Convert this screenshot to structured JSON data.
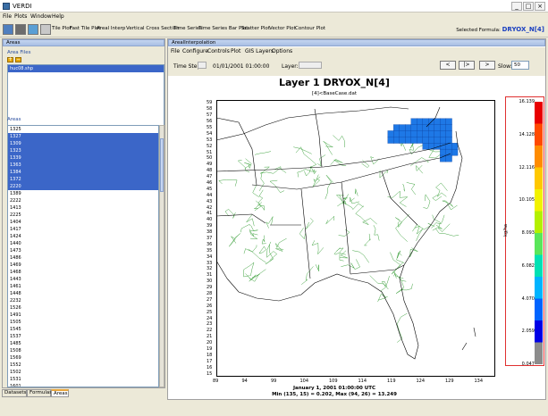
{
  "window": {
    "title": "VERDI"
  },
  "menu": [
    "File",
    "Plots",
    "Window",
    "Help"
  ],
  "toolbar": {
    "buttons": [
      "Tile Plot",
      "Fast Tile Plot",
      "Areal Interp",
      "Vertical Cross Section",
      "Time Series",
      "Time Series Bar Plot",
      "Scatter Plot",
      "Vector Plot",
      "Contour Plot"
    ],
    "selected_formula_label": "Selected Formula:",
    "selected_formula": "DRYOX_N[4]"
  },
  "left_panel": {
    "header": "Areas",
    "area_files_label": "Area Files",
    "area_files": [
      "huc08.shp"
    ],
    "areas_label": "Areas",
    "areas": [
      {
        "id": "1325",
        "selected": false
      },
      {
        "id": "1327",
        "selected": true
      },
      {
        "id": "1309",
        "selected": true
      },
      {
        "id": "1323",
        "selected": true
      },
      {
        "id": "1339",
        "selected": true
      },
      {
        "id": "1363",
        "selected": true
      },
      {
        "id": "1384",
        "selected": true
      },
      {
        "id": "1372",
        "selected": true
      },
      {
        "id": "2220",
        "selected": true
      },
      {
        "id": "1389",
        "selected": false
      },
      {
        "id": "2222",
        "selected": false
      },
      {
        "id": "1413",
        "selected": false
      },
      {
        "id": "2225",
        "selected": false
      },
      {
        "id": "1404",
        "selected": false
      },
      {
        "id": "1417",
        "selected": false
      },
      {
        "id": "1424",
        "selected": false
      },
      {
        "id": "1440",
        "selected": false
      },
      {
        "id": "1473",
        "selected": false
      },
      {
        "id": "1486",
        "selected": false
      },
      {
        "id": "1469",
        "selected": false
      },
      {
        "id": "1468",
        "selected": false
      },
      {
        "id": "1443",
        "selected": false
      },
      {
        "id": "1461",
        "selected": false
      },
      {
        "id": "1448",
        "selected": false
      },
      {
        "id": "2232",
        "selected": false
      },
      {
        "id": "1526",
        "selected": false
      },
      {
        "id": "1491",
        "selected": false
      },
      {
        "id": "1505",
        "selected": false
      },
      {
        "id": "1545",
        "selected": false
      },
      {
        "id": "1537",
        "selected": false
      },
      {
        "id": "1485",
        "selected": false
      },
      {
        "id": "1508",
        "selected": false
      },
      {
        "id": "1569",
        "selected": false
      },
      {
        "id": "1552",
        "selected": false
      },
      {
        "id": "1502",
        "selected": false
      },
      {
        "id": "1531",
        "selected": false
      },
      {
        "id": "1601",
        "selected": false
      }
    ],
    "tabs": [
      "Datasets",
      "Formulas",
      "Areas"
    ],
    "active_tab": "Areas"
  },
  "right_panel": {
    "header": "ArealInterpolation",
    "menu": [
      "File",
      "Configure",
      "Controls",
      "Plot",
      "GIS Layers",
      "Options"
    ],
    "time_step_label": "Time Step:",
    "time_step_value": "01/01/2001 01:00:00",
    "layer_label": "Layer:",
    "nav_buttons": [
      "<",
      "|>",
      ">"
    ],
    "slow_label": "Slow:",
    "slow_value": "50"
  },
  "chart_data": {
    "type": "heatmap",
    "title": "Layer 1 DRYOX_N[4]",
    "subtitle": "[4]<BaseCase.dat",
    "xlabel_line1": "January 1, 2001 01:00:00 UTC",
    "xlabel_line2": "Min (135, 15) = 0.202, Max (94, 26) = 13.249",
    "ylabel": "",
    "x_ticks": [
      "89",
      "94",
      "99",
      "104",
      "109",
      "114",
      "119",
      "124",
      "129",
      "134"
    ],
    "y_ticks": [
      59,
      58,
      57,
      56,
      55,
      54,
      53,
      52,
      51,
      50,
      49,
      48,
      47,
      46,
      45,
      44,
      43,
      42,
      41,
      40,
      39,
      38,
      37,
      36,
      35,
      34,
      33,
      32,
      31,
      30,
      29,
      28,
      27,
      26,
      25,
      24,
      23,
      22,
      21,
      20,
      19,
      18,
      17,
      16,
      15
    ],
    "xlim": [
      89,
      137
    ],
    "ylim": [
      14.5,
      59.5
    ],
    "legend": {
      "unit": "kg/ha",
      "levels": [
        "16.139",
        "14.128",
        "12.116",
        "10.105",
        "8.093",
        "6.082",
        "4.070",
        "2.059",
        "0.047"
      ],
      "colors": [
        "#e80000",
        "#ff4a00",
        "#ff8c00",
        "#ffc800",
        "#f2f200",
        "#b4f000",
        "#5ae65a",
        "#00e1b4",
        "#00b4ff",
        "#0064ff",
        "#0000e6",
        "#8c8c8c"
      ]
    },
    "highlighted_cells": [
      [
        119,
        53
      ],
      [
        120,
        53
      ],
      [
        121,
        53
      ],
      [
        122,
        53
      ],
      [
        123,
        53
      ],
      [
        124,
        53
      ],
      [
        125,
        53
      ],
      [
        126,
        53
      ],
      [
        127,
        53
      ],
      [
        128,
        53
      ],
      [
        129,
        53
      ],
      [
        119,
        54
      ],
      [
        120,
        54
      ],
      [
        121,
        54
      ],
      [
        122,
        54
      ],
      [
        123,
        54
      ],
      [
        124,
        54
      ],
      [
        125,
        54
      ],
      [
        126,
        54
      ],
      [
        127,
        54
      ],
      [
        128,
        54
      ],
      [
        129,
        54
      ],
      [
        120,
        55
      ],
      [
        121,
        55
      ],
      [
        122,
        55
      ],
      [
        123,
        55
      ],
      [
        124,
        55
      ],
      [
        125,
        55
      ],
      [
        126,
        55
      ],
      [
        127,
        55
      ],
      [
        128,
        55
      ],
      [
        129,
        55
      ],
      [
        123,
        56
      ],
      [
        124,
        56
      ],
      [
        125,
        56
      ],
      [
        126,
        56
      ],
      [
        127,
        56
      ],
      [
        128,
        56
      ],
      [
        129,
        56
      ],
      [
        125,
        52
      ],
      [
        126,
        52
      ],
      [
        127,
        52
      ],
      [
        128,
        52
      ],
      [
        129,
        52
      ],
      [
        130,
        52
      ],
      [
        128,
        51
      ],
      [
        129,
        51
      ],
      [
        130,
        51
      ],
      [
        128,
        50
      ],
      [
        129,
        50
      ]
    ],
    "highlight_color": "#1e78e6"
  }
}
